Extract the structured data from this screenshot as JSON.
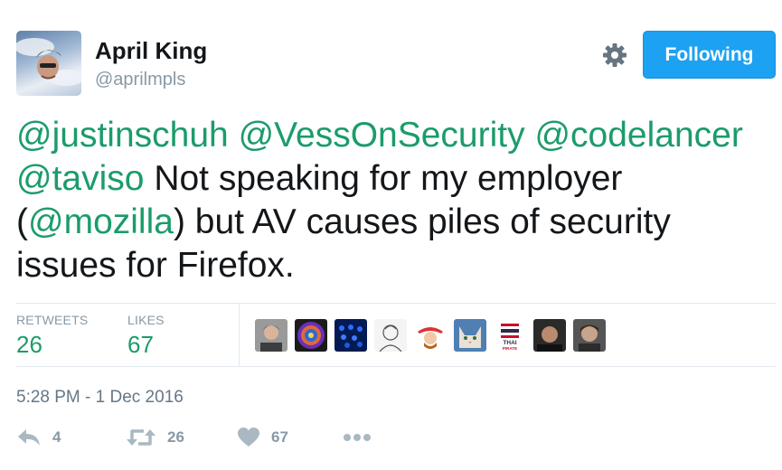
{
  "author": {
    "name": "April King",
    "handle": "@aprilmpls"
  },
  "follow_button": {
    "label": "Following"
  },
  "tweet": {
    "segments": [
      {
        "text": "@justinschuh",
        "mention": true
      },
      {
        "text": " ",
        "mention": false
      },
      {
        "text": "@VessOnSecurity",
        "mention": true
      },
      {
        "text": " ",
        "mention": false
      },
      {
        "text": "@codelancer",
        "mention": true
      },
      {
        "text": " ",
        "mention": false
      },
      {
        "text": "@taviso",
        "mention": true
      },
      {
        "text": " Not speaking for my employer (",
        "mention": false
      },
      {
        "text": "@mozilla",
        "mention": true
      },
      {
        "text": ") but AV causes piles of security issues for Firefox.",
        "mention": false
      }
    ]
  },
  "stats": {
    "retweets_label": "RETWEETS",
    "retweets_value": "26",
    "likes_label": "LIKES",
    "likes_value": "67"
  },
  "likers": [
    {
      "icon": "user-avatar-1"
    },
    {
      "icon": "user-avatar-2"
    },
    {
      "icon": "user-avatar-3"
    },
    {
      "icon": "user-avatar-4"
    },
    {
      "icon": "user-avatar-5"
    },
    {
      "icon": "user-avatar-6"
    },
    {
      "icon": "user-avatar-thai-pirate"
    },
    {
      "icon": "user-avatar-8"
    },
    {
      "icon": "user-avatar-9"
    }
  ],
  "timestamp": "5:28 PM - 1 Dec 2016",
  "actions": {
    "reply_count": "4",
    "retweet_count": "26",
    "like_count": "67"
  },
  "colors": {
    "mention": "#1b9c6a",
    "button": "#1da1f2",
    "muted": "#8899a6",
    "icon": "#aab8c2"
  },
  "liker_text": {
    "thai_line1": "THAI",
    "thai_line2": "PIRATE"
  }
}
